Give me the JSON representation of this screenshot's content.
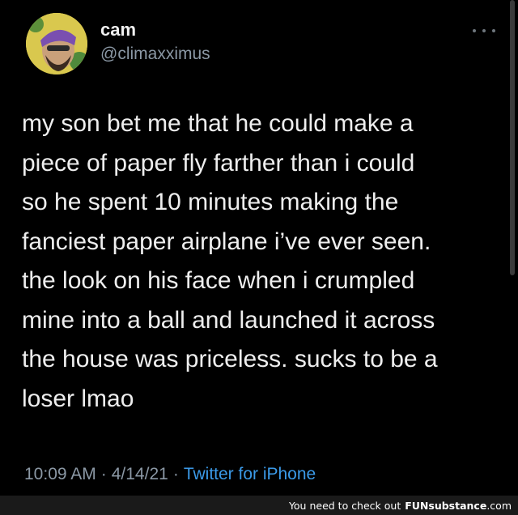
{
  "user": {
    "display_name": "cam",
    "handle": "@climaxximus"
  },
  "tweet": {
    "text": "my son bet me that he could make a\npiece of paper fly farther than i could\nso he spent 10 minutes making the\nfanciest paper airplane i’ve ever seen.\nthe look on his face when i crumpled\nmine into a ball and launched it across\nthe house was priceless. sucks to be a\nloser lmao",
    "time": "10:09 AM",
    "separator": "·",
    "date": "4/14/21",
    "source": "Twitter for iPhone"
  },
  "footer": {
    "text": "You need to check out",
    "brand_part1": "FUN",
    "brand_part2": "substance",
    "brand_domain": ".com"
  },
  "icons": {
    "more": "more-horizontal-icon"
  },
  "colors": {
    "background": "#000000",
    "link": "#3b9ae8",
    "muted": "#8b98a5",
    "footer_bg": "#1a1a1a"
  }
}
